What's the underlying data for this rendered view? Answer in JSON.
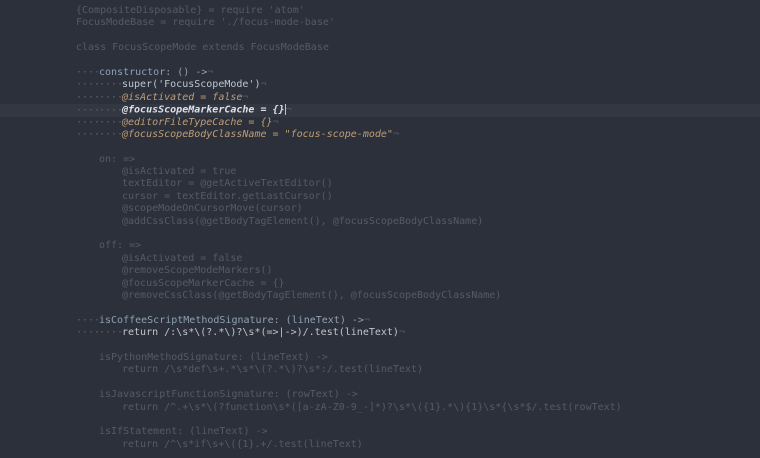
{
  "editor": {
    "background": "#2b303b",
    "focus_mode": "focus-scope-mode",
    "lines": [
      "{CompositeDisposable} = require 'atom'",
      "FocusModeBase = require './focus-mode-base'",
      "",
      "class FocusScopeMode extends FocusModeBase",
      "",
      "constructor: () ->",
      "super('FocusScopeMode')",
      "@isActivated = false",
      "@focusScopeMarkerCache = {}",
      "@editorFileTypeCache = {}",
      "@focusScopeBodyClassName = \"focus-scope-mode\"",
      "",
      "on: =>",
      "@isActivated = true",
      "textEditor = @getActiveTextEditor()",
      "cursor = textEditor.getLastCursor()",
      "@scopeModeOnCursorMove(cursor)",
      "@addCssClass(@getBodyTagElement(), @focusScopeBodyClassName)",
      "",
      "off: =>",
      "@isActivated = false",
      "@removeScopeModeMarkers()",
      "@focusScopeMarkerCache = {}",
      "@removeCssClass(@getBodyTagElement(), @focusScopeBodyClassName)",
      "",
      "isCoffeeScriptMethodSignature: (lineText) ->",
      "return /:\\s*\\(?.*\\)?\\s*(=>|->)/.test(lineText)",
      "",
      "isPythonMethodSignature: (lineText) ->",
      "return /\\s*def\\s+.*\\s*\\(?.*\\)?\\s*:/.test(lineText)",
      "",
      "isJavascriptFunctionSignature: (rowText) ->",
      "return /^.+\\s*\\(?function\\s*([a-zA-Z0-9_-]*)?\\s*\\({1}.*\\){1}\\s*{\\s*$/.test(rowText)",
      "",
      "isIfStatement: (lineText) ->",
      "return /^\\s*if\\s+\\({1}.+/.test(lineText)"
    ]
  }
}
